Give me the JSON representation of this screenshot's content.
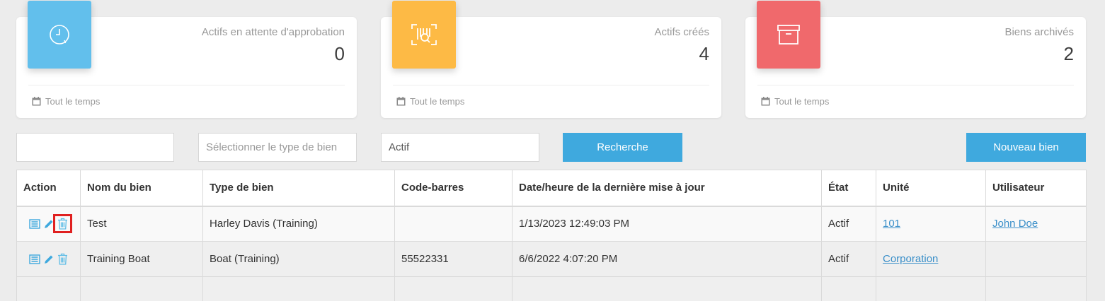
{
  "cards": [
    {
      "title": "Actifs en attente d'approbation",
      "value": "0",
      "footer": "Tout le temps",
      "icon": "clock-icon",
      "color": "#62bfec"
    },
    {
      "title": "Actifs créés",
      "value": "4",
      "footer": "Tout le temps",
      "icon": "barcode-scan-icon",
      "color": "#fdba45"
    },
    {
      "title": "Biens archivés",
      "value": "2",
      "footer": "Tout le temps",
      "icon": "archive-box-icon",
      "color": "#f0696c"
    }
  ],
  "filters": {
    "search_value": "",
    "type_placeholder": "Sélectionner le type de bien",
    "status_value": "Actif",
    "search_button": "Recherche",
    "new_button": "Nouveau bien"
  },
  "table": {
    "headers": [
      "Action",
      "Nom du bien",
      "Type de bien",
      "Code-barres",
      "Date/heure de la dernière mise à jour",
      "État",
      "Unité",
      "Utilisateur"
    ],
    "rows": [
      {
        "name": "Test",
        "type": "Harley Davis (Training)",
        "barcode": "",
        "updated": "1/13/2023 12:49:03 PM",
        "status": "Actif",
        "unit": "101",
        "user": "John Doe"
      },
      {
        "name": "Training Boat",
        "type": "Boat (Training)",
        "barcode": "55522331",
        "updated": "6/6/2022 4:07:20 PM",
        "status": "Actif",
        "unit": "Corporation",
        "user": ""
      }
    ],
    "action_icons": [
      "details-icon",
      "edit-pencil-icon",
      "delete-trash-icon"
    ]
  },
  "colors": {
    "accent": "#3fa9de",
    "link": "#3a8fc9",
    "highlight": "#e02020"
  }
}
